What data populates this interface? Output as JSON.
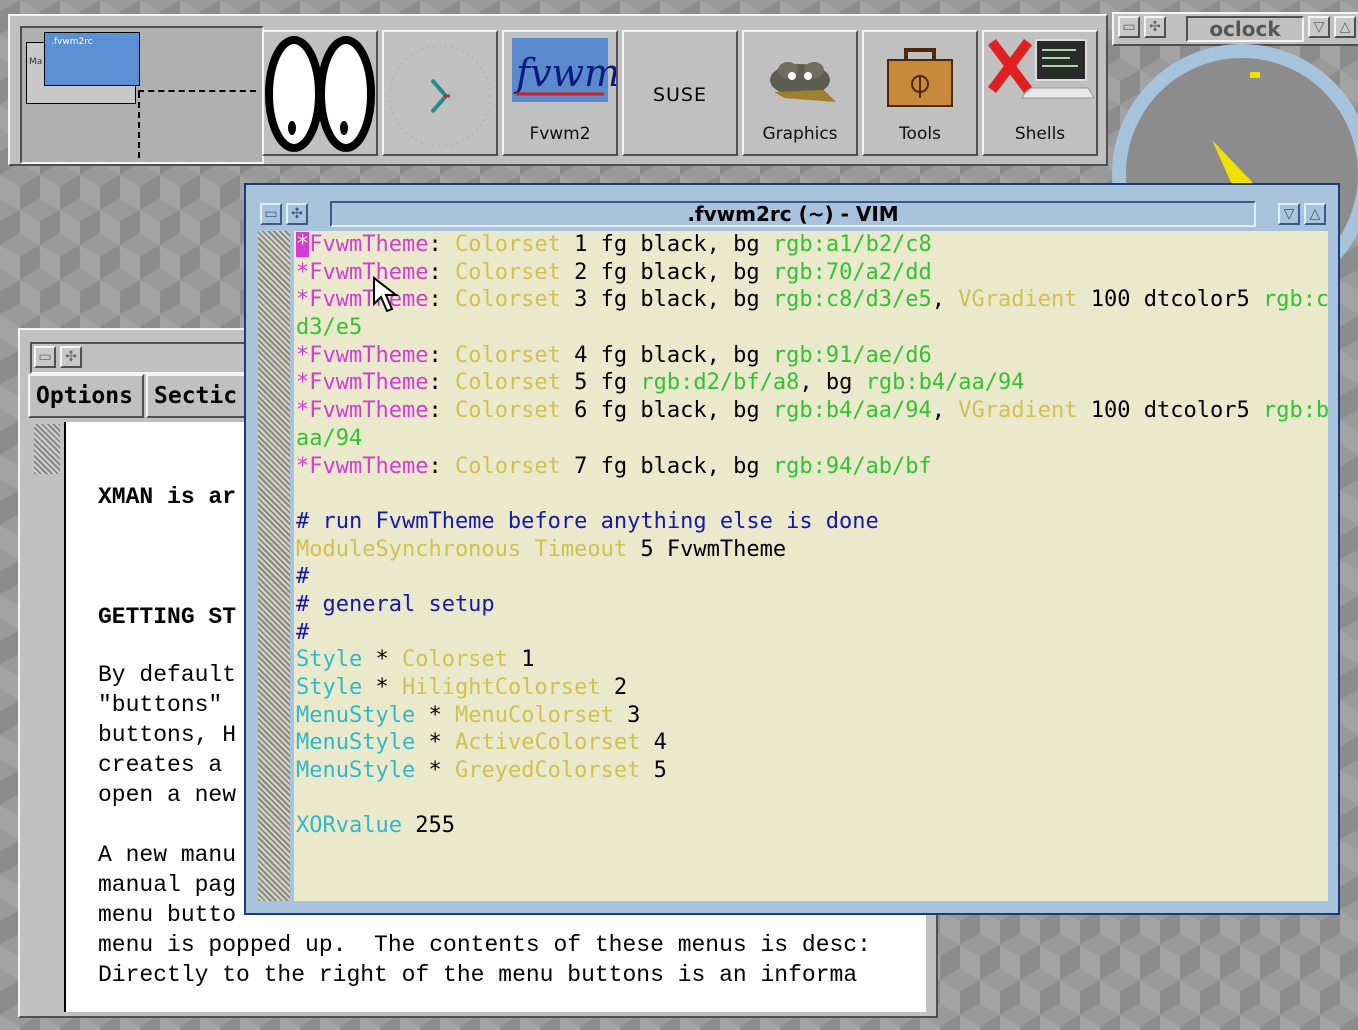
{
  "colors": {
    "desktop": "#8c8c8c",
    "panel": "#c0c0c0",
    "vim_frame": "#a9c3dc",
    "vim_bg": "#ebe9cc",
    "magenta": "#d43cd4",
    "yellow": "#d2c050",
    "green": "#34c234",
    "cyan": "#30b8c8",
    "blue": "#1818a8",
    "clock_hand": "#f0e000"
  },
  "buttonbar": {
    "pager_window_label": ".fvwm2rc",
    "pager_small_label": "Ma",
    "buttons": [
      {
        "label": "",
        "icon": "xeyes-icon"
      },
      {
        "label": "",
        "icon": "analog-clock-icon"
      },
      {
        "label": "Fvwm2",
        "icon": "fvwm-logo-icon",
        "logo_text": "fvwm"
      },
      {
        "label": "SUSE",
        "icon": ""
      },
      {
        "label": "Graphics",
        "icon": "gimp-icon"
      },
      {
        "label": "Tools",
        "icon": "toolbox-icon"
      },
      {
        "label": "Shells",
        "icon": "xterm-icon"
      }
    ]
  },
  "oclock": {
    "title": "oclock"
  },
  "xman": {
    "menu": [
      "Options",
      "Sectic"
    ],
    "lines": [
      "XMAN is ar",
      "GETTING ST",
      "By default",
      "\"buttons\"",
      "buttons, H",
      "creates a",
      "open a new",
      "A new manu",
      "manual pag",
      "menu butto",
      "menu is popped up.  The contents of these menus is desc:",
      "Directly to the right of the menu buttons is an informa"
    ]
  },
  "vim": {
    "title": ".fvwm2rc (~) - VIM",
    "lines": [
      [
        [
          "mg",
          "*"
        ],
        [
          "mg",
          "FvwmTheme"
        ],
        [
          "bk",
          ": "
        ],
        [
          "yl",
          "Colorset"
        ],
        [
          "bk",
          " 1 fg black, bg "
        ],
        [
          "gr",
          "rgb:a1/b2/c8"
        ]
      ],
      [
        [
          "mg",
          "*FvwmTheme"
        ],
        [
          "bk",
          ": "
        ],
        [
          "yl",
          "Colorset"
        ],
        [
          "bk",
          " 2 fg black, bg "
        ],
        [
          "gr",
          "rgb:70/a2/dd"
        ]
      ],
      [
        [
          "mg",
          "*FvwmTheme"
        ],
        [
          "bk",
          ": "
        ],
        [
          "yl",
          "Colorset"
        ],
        [
          "bk",
          " 3 fg black, bg "
        ],
        [
          "gr",
          "rgb:c8/d3/e5"
        ],
        [
          "bk",
          ", "
        ],
        [
          "yl",
          "VGradient"
        ],
        [
          "bk",
          " 100 dtcolor5 "
        ],
        [
          "gr",
          "rgb:c8/"
        ]
      ],
      [
        [
          "gr",
          "d3/e5"
        ]
      ],
      [
        [
          "mg",
          "*FvwmTheme"
        ],
        [
          "bk",
          ": "
        ],
        [
          "yl",
          "Colorset"
        ],
        [
          "bk",
          " 4 fg black, bg "
        ],
        [
          "gr",
          "rgb:91/ae/d6"
        ]
      ],
      [
        [
          "mg",
          "*FvwmTheme"
        ],
        [
          "bk",
          ": "
        ],
        [
          "yl",
          "Colorset"
        ],
        [
          "bk",
          " 5 fg "
        ],
        [
          "gr",
          "rgb:d2/bf/a8"
        ],
        [
          "bk",
          ", bg "
        ],
        [
          "gr",
          "rgb:b4/aa/94"
        ]
      ],
      [
        [
          "mg",
          "*FvwmTheme"
        ],
        [
          "bk",
          ": "
        ],
        [
          "yl",
          "Colorset"
        ],
        [
          "bk",
          " 6 fg black, bg "
        ],
        [
          "gr",
          "rgb:b4/aa/94"
        ],
        [
          "bk",
          ", "
        ],
        [
          "yl",
          "VGradient"
        ],
        [
          "bk",
          " 100 dtcolor5 "
        ],
        [
          "gr",
          "rgb:b4/"
        ]
      ],
      [
        [
          "gr",
          "aa/94"
        ]
      ],
      [
        [
          "mg",
          "*FvwmTheme"
        ],
        [
          "bk",
          ": "
        ],
        [
          "yl",
          "Colorset"
        ],
        [
          "bk",
          " 7 fg black, bg "
        ],
        [
          "gr",
          "rgb:94/ab/bf"
        ]
      ],
      [],
      [
        [
          "bl",
          "# run FvwmTheme before anything else is done"
        ]
      ],
      [
        [
          "yl",
          "ModuleSynchronous"
        ],
        [
          "bk",
          " "
        ],
        [
          "yl",
          "Timeout"
        ],
        [
          "bk",
          " 5 FvwmTheme"
        ]
      ],
      [
        [
          "bl",
          "#"
        ]
      ],
      [
        [
          "bl",
          "# general setup"
        ]
      ],
      [
        [
          "bl",
          "#"
        ]
      ],
      [
        [
          "cy",
          "Style"
        ],
        [
          "bk",
          " * "
        ],
        [
          "yl",
          "Colorset"
        ],
        [
          "bk",
          " 1"
        ]
      ],
      [
        [
          "cy",
          "Style"
        ],
        [
          "bk",
          " * "
        ],
        [
          "yl",
          "HilightColorset"
        ],
        [
          "bk",
          " 2"
        ]
      ],
      [
        [
          "cy",
          "MenuStyle"
        ],
        [
          "bk",
          " * "
        ],
        [
          "yl",
          "MenuColorset"
        ],
        [
          "bk",
          " 3"
        ]
      ],
      [
        [
          "cy",
          "MenuStyle"
        ],
        [
          "bk",
          " * "
        ],
        [
          "yl",
          "ActiveColorset"
        ],
        [
          "bk",
          " 4"
        ]
      ],
      [
        [
          "cy",
          "MenuStyle"
        ],
        [
          "bk",
          " * "
        ],
        [
          "yl",
          "GreyedColorset"
        ],
        [
          "bk",
          " 5"
        ]
      ],
      [],
      [
        [
          "cy",
          "XORvalue"
        ],
        [
          "bk",
          " 255"
        ]
      ]
    ]
  }
}
